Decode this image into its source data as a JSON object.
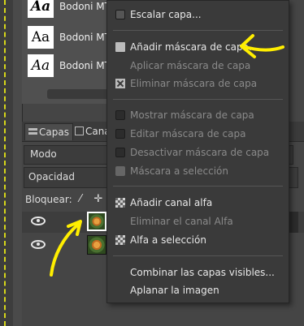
{
  "fonts_panel": {
    "items": [
      {
        "sample": "Aa",
        "name": "Bodoni MT"
      },
      {
        "sample": "Aa",
        "name": "Bodoni MT"
      },
      {
        "sample": "Aa",
        "name": "Bodoni MT"
      }
    ]
  },
  "layers_panel": {
    "tabs": [
      {
        "label": "Capas",
        "icon": "layers-icon"
      },
      {
        "label": "Cana",
        "icon": "channels-icon"
      }
    ],
    "mode_label": "Modo",
    "opacity_label": "Opacidad",
    "lock_label": "Bloquear:",
    "lock_icons": [
      "lock-pixels-icon",
      "lock-position-icon"
    ]
  },
  "context_menu": {
    "items": [
      {
        "label": "Escalar capa...",
        "enabled": true,
        "icon": "scale-layer-icon"
      },
      {
        "label": "Añadir máscara de capa...",
        "enabled": true,
        "icon": "add-layer-mask-icon"
      },
      {
        "label": "Aplicar máscara de capa",
        "enabled": false,
        "icon": ""
      },
      {
        "label": "Eliminar máscara de capa",
        "enabled": false,
        "icon": "delete-mask-icon"
      },
      {
        "label": "Mostrar máscara de capa",
        "enabled": false,
        "icon": "checkbox-icon"
      },
      {
        "label": "Editar máscara de capa",
        "enabled": false,
        "icon": "checkbox-icon"
      },
      {
        "label": "Desactivar máscara de capa",
        "enabled": false,
        "icon": "checkbox-icon"
      },
      {
        "label": "Máscara a selección",
        "enabled": false,
        "icon": "mask-to-selection-icon"
      },
      {
        "label": "Añadir canal alfa",
        "enabled": true,
        "icon": "add-alpha-icon"
      },
      {
        "label": "Eliminar el canal Alfa",
        "enabled": false,
        "icon": ""
      },
      {
        "label": "Alfa a selección",
        "enabled": true,
        "icon": "alpha-to-selection-icon"
      },
      {
        "label": "Combinar las capas visibles...",
        "enabled": true,
        "icon": ""
      },
      {
        "label": "Aplanar la imagen",
        "enabled": true,
        "icon": ""
      }
    ]
  },
  "colors": {
    "annotation": "#ffee00",
    "menu_bg": "#3a3a3a",
    "panel_bg": "#454545"
  }
}
